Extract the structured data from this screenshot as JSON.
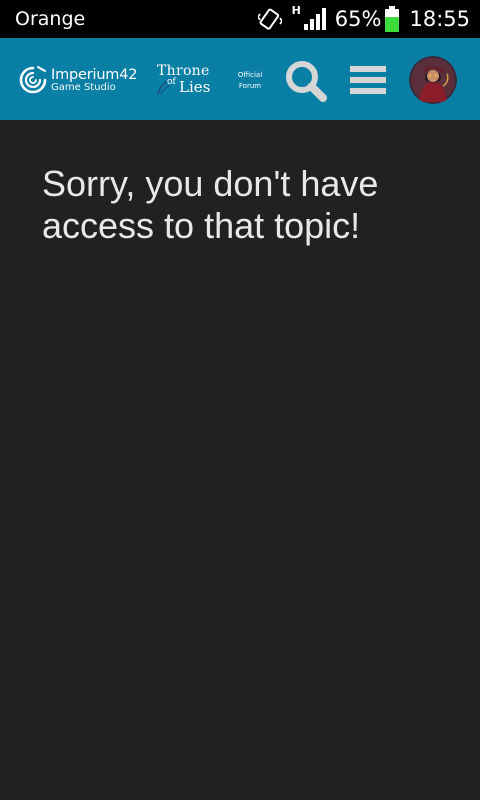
{
  "status_bar": {
    "carrier": "Orange",
    "network_type": "H",
    "battery_percent": "65%",
    "battery_level": 0.65,
    "time": "18:55",
    "icons": [
      "vibrate-icon",
      "signal-icon",
      "battery-icon"
    ]
  },
  "header": {
    "studio_logo": {
      "name": "Imperium42",
      "subtitle": "Game Studio"
    },
    "game_logo": {
      "line1": "Throne",
      "of": "of",
      "line2": "Lies"
    },
    "forum_tag": {
      "line1": "Official",
      "line2": "Forum"
    },
    "search_icon": "search-icon",
    "menu_icon": "hamburger-menu-icon",
    "avatar_icon": "user-avatar"
  },
  "main": {
    "message": "Sorry, you don't have access to that topic!"
  },
  "colors": {
    "status_bar_bg": "#000000",
    "header_bg": "#0a7fa6",
    "page_bg": "#212121",
    "message_text": "#e8e8e8",
    "header_icons": "#d6d6d6",
    "battery_fill": "#3ddc3d"
  }
}
